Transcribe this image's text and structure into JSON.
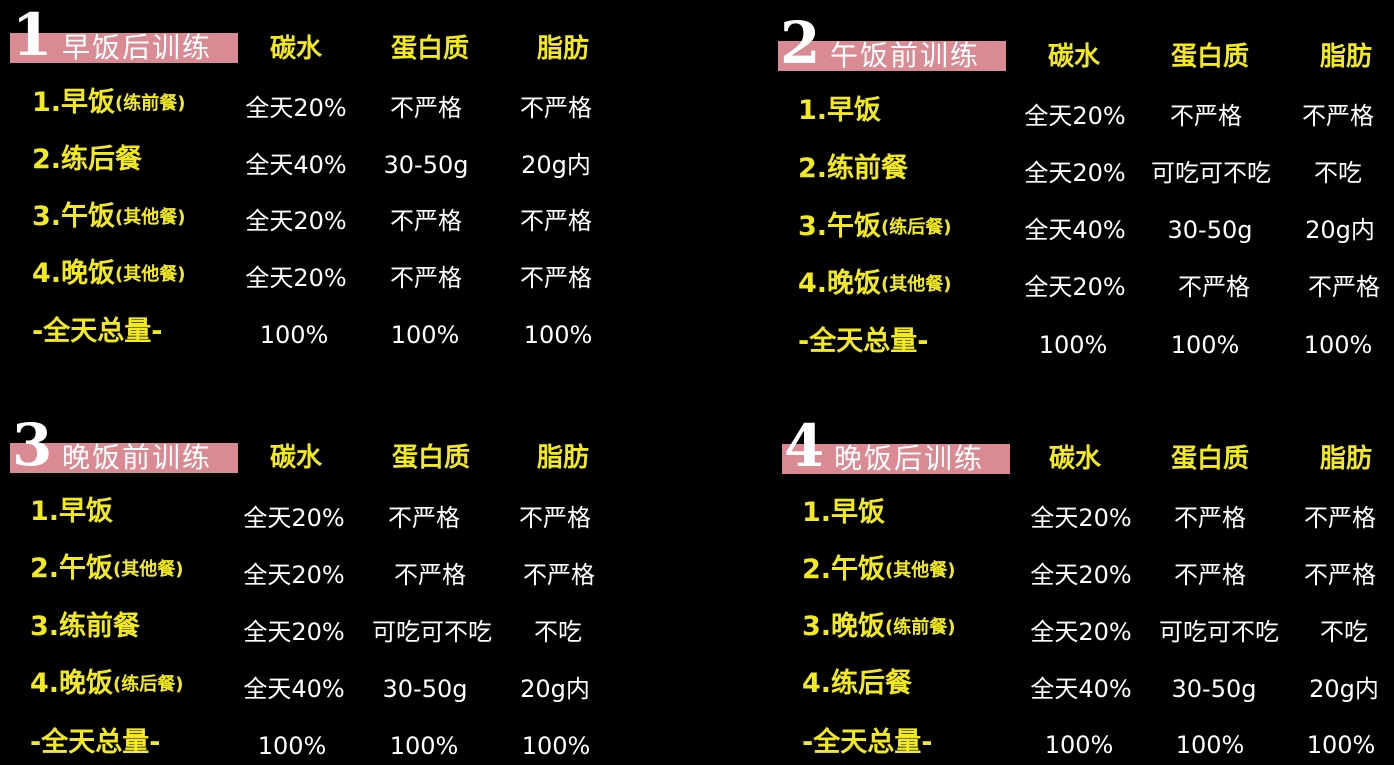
{
  "colors": {
    "background": "#000000",
    "title_band": "#d98a93",
    "label_yellow": "#f2ea1f",
    "value_white": "#ffffff"
  },
  "panels": [
    {
      "number": "1",
      "title": "早饭后训练",
      "headers": [
        "碳水",
        "蛋白质",
        "脂肪"
      ],
      "rows": [
        {
          "label": "1.早饭",
          "sub": "(练前餐)",
          "values": [
            "全天20%",
            "不严格",
            "不严格"
          ]
        },
        {
          "label": "2.练后餐",
          "sub": "",
          "values": [
            "全天40%",
            "30-50g",
            "20g内"
          ]
        },
        {
          "label": "3.午饭",
          "sub": "(其他餐)",
          "values": [
            "全天20%",
            "不严格",
            "不严格"
          ]
        },
        {
          "label": "4.晚饭",
          "sub": "(其他餐)",
          "values": [
            "全天20%",
            "不严格",
            "不严格"
          ]
        },
        {
          "label": "-全天总量-",
          "sub": "",
          "values": [
            "100%",
            "100%",
            "100%"
          ]
        }
      ]
    },
    {
      "number": "2",
      "title": "午饭前训练",
      "headers": [
        "碳水",
        "蛋白质",
        "脂肪"
      ],
      "rows": [
        {
          "label": "1.早饭",
          "sub": "",
          "values": [
            "全天20%",
            "不严格",
            "不严格"
          ]
        },
        {
          "label": "2.练前餐",
          "sub": "",
          "values": [
            "全天20%",
            "可吃可不吃",
            "不吃"
          ]
        },
        {
          "label": "3.午饭",
          "sub": "(练后餐)",
          "values": [
            "全天40%",
            "30-50g",
            "20g内"
          ]
        },
        {
          "label": "4.晚饭",
          "sub": "(其他餐)",
          "values": [
            "全天20%",
            "不严格",
            "不严格"
          ]
        },
        {
          "label": "-全天总量-",
          "sub": "",
          "values": [
            "100%",
            "100%",
            "100%"
          ]
        }
      ]
    },
    {
      "number": "3",
      "title": "晚饭前训练",
      "headers": [
        "碳水",
        "蛋白质",
        "脂肪"
      ],
      "rows": [
        {
          "label": "1.早饭",
          "sub": "",
          "values": [
            "全天20%",
            "不严格",
            "不严格"
          ]
        },
        {
          "label": "2.午饭",
          "sub": "(其他餐)",
          "values": [
            "全天20%",
            "不严格",
            "不严格"
          ]
        },
        {
          "label": "3.练前餐",
          "sub": "",
          "values": [
            "全天20%",
            "可吃可不吃",
            "不吃"
          ]
        },
        {
          "label": "4.晚饭",
          "sub": "(练后餐)",
          "values": [
            "全天40%",
            "30-50g",
            "20g内"
          ]
        },
        {
          "label": "-全天总量-",
          "sub": "",
          "values": [
            "100%",
            "100%",
            "100%"
          ]
        }
      ]
    },
    {
      "number": "4",
      "title": "晚饭后训练",
      "headers": [
        "碳水",
        "蛋白质",
        "脂肪"
      ],
      "rows": [
        {
          "label": "1.早饭",
          "sub": "",
          "values": [
            "全天20%",
            "不严格",
            "不严格"
          ]
        },
        {
          "label": "2.午饭",
          "sub": "(其他餐)",
          "values": [
            "全天20%",
            "不严格",
            "不严格"
          ]
        },
        {
          "label": "3.晚饭",
          "sub": "(练前餐)",
          "values": [
            "全天20%",
            "可吃可不吃",
            "不吃"
          ]
        },
        {
          "label": "4.练后餐",
          "sub": "",
          "values": [
            "全天40%",
            "30-50g",
            "20g内"
          ]
        },
        {
          "label": "-全天总量-",
          "sub": "",
          "values": [
            "100%",
            "100%",
            "100%"
          ]
        }
      ]
    }
  ]
}
